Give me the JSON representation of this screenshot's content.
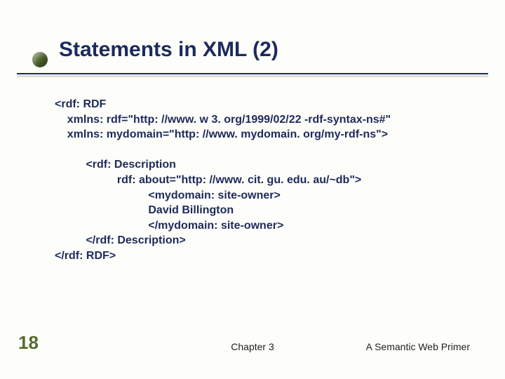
{
  "title": "Statements in XML (2)",
  "code": "<rdf: RDF\n    xmlns: rdf=\"http: //www. w 3. org/1999/02/22 -rdf-syntax-ns#\"\n    xmlns: mydomain=\"http: //www. mydomain. org/my-rdf-ns\">\n\n          <rdf: Description\n                    rdf: about=\"http: //www. cit. gu. edu. au/~db\">\n                              <mydomain: site-owner>\n                              David Billington\n                              </mydomain: site-owner>\n          </rdf: Description>\n</rdf: RDF>",
  "slide_number": "18",
  "footer_center": "Chapter 3",
  "footer_right": "A Semantic Web Primer"
}
